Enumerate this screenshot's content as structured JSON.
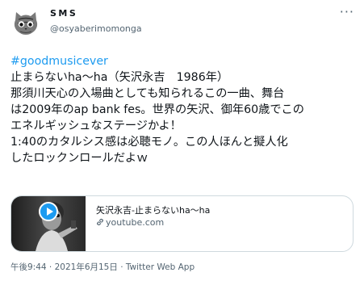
{
  "author": {
    "display_name": "SMS",
    "handle": "@osyaberimomonga"
  },
  "tweet": {
    "hashtag": "#goodmusicever",
    "lines": [
      "止まらないha～ha（矢沢永吉　1986年）",
      "那須川天心の入場曲としても知られるこの一曲、舞台",
      "は2009年のap bank fes。世界の矢沢、御年60歳でこの",
      "エネルギッシュなステージかよ！",
      "1:40のカタルシス感は必聴モノ。この人ほんと擬人化",
      "したロックンロールだよｗ"
    ]
  },
  "card": {
    "title": "矢沢永吉-止まらないha～ha",
    "domain": "youtube.com"
  },
  "footer": {
    "timestamp": "午後9:44 · 2021年6月15日 · Twitter Web App"
  },
  "colors": {
    "link": "#1d9bf0",
    "muted": "#536471"
  }
}
